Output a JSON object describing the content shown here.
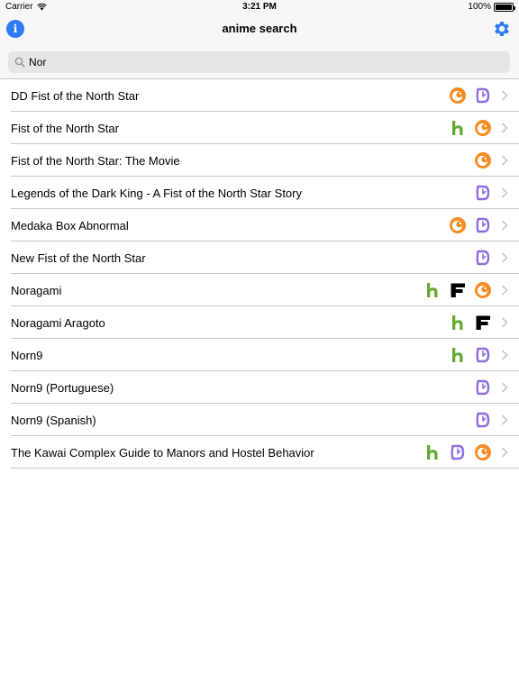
{
  "status_bar": {
    "carrier": "Carrier",
    "time": "3:21 PM",
    "battery": "100%"
  },
  "nav": {
    "title": "anime search"
  },
  "search": {
    "value": "Nor"
  },
  "results": [
    {
      "title": "DD Fist of the North Star",
      "services": [
        "crunchyroll-icon",
        "viki-icon"
      ]
    },
    {
      "title": "Fist of the North Star",
      "services": [
        "hulu-icon",
        "crunchyroll-icon"
      ]
    },
    {
      "title": "Fist of the North Star: The Movie",
      "services": [
        "crunchyroll-icon"
      ]
    },
    {
      "title": "Legends of the Dark King - A Fist of the North Star Story",
      "services": [
        "viki-icon"
      ]
    },
    {
      "title": "Medaka Box Abnormal",
      "services": [
        "crunchyroll-icon",
        "viki-icon"
      ]
    },
    {
      "title": "New Fist of the North Star",
      "services": [
        "viki-icon"
      ]
    },
    {
      "title": "Noragami",
      "services": [
        "hulu-icon",
        "funimation-icon",
        "crunchyroll-icon"
      ]
    },
    {
      "title": "Noragami Aragoto",
      "services": [
        "hulu-icon",
        "funimation-icon"
      ]
    },
    {
      "title": "Norn9",
      "services": [
        "hulu-icon",
        "viki-icon"
      ]
    },
    {
      "title": "Norn9 (Portuguese)",
      "services": [
        "viki-icon"
      ]
    },
    {
      "title": "Norn9 (Spanish)",
      "services": [
        "viki-icon"
      ]
    },
    {
      "title": "The Kawai Complex Guide to Manors and Hostel Behavior",
      "services": [
        "hulu-icon",
        "viki-icon",
        "crunchyroll-icon"
      ]
    }
  ],
  "colors": {
    "accent": "#2f7bf0",
    "crunchyroll": "#f78b24",
    "hulu": "#66aa33",
    "viki": "#8f6fe0",
    "funimation": "#000000"
  }
}
